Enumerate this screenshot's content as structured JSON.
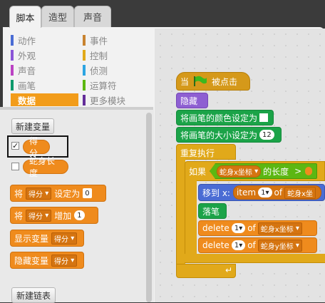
{
  "tabs": [
    "脚本",
    "造型",
    "声音"
  ],
  "categories": {
    "left": [
      {
        "label": "动作",
        "color": "#4a6cd4"
      },
      {
        "label": "外观",
        "color": "#8a55d7"
      },
      {
        "label": "声音",
        "color": "#bb42c3"
      },
      {
        "label": "画笔",
        "color": "#0e9a6c"
      },
      {
        "label": "数据",
        "color": "#f29c1a"
      }
    ],
    "right": [
      {
        "label": "事件",
        "color": "#c88330"
      },
      {
        "label": "控制",
        "color": "#e1a91a"
      },
      {
        "label": "侦测",
        "color": "#2ca5e2"
      },
      {
        "label": "运算符",
        "color": "#5cb712"
      },
      {
        "label": "更多模块",
        "color": "#632d99"
      }
    ]
  },
  "palette": {
    "new_variable": "新建变量",
    "var1": "得分",
    "var2": "蛇身长度",
    "set_block": {
      "pre": "将",
      "var": "得分",
      "post": "设定为",
      "val": "0"
    },
    "change_block": {
      "pre": "将",
      "var": "得分",
      "post": "增加",
      "val": "1"
    },
    "show_block": {
      "pre": "显示变量",
      "var": "得分"
    },
    "hide_block": {
      "pre": "隐藏变量",
      "var": "得分"
    },
    "new_list": "新建链表",
    "check_mark": "✓"
  },
  "script": {
    "hat": {
      "pre": "当",
      "post": "被点击"
    },
    "hide": "隐藏",
    "pen_color": "将画笔的颜色设定为",
    "pen_size": "将画笔的大小设定为",
    "pen_size_val": "12",
    "forever": "重复执行",
    "if_label": "如果",
    "list1": "蛇身x坐标",
    "length_of": "的长度",
    "gt": ">",
    "goto": "移到 x:",
    "item": "item",
    "item_idx": "1",
    "of": "of",
    "list1_short": "蛇身x坐",
    "pen_down": "落笔",
    "delete": "delete",
    "del_idx": "1",
    "list2": "蛇身y坐标"
  }
}
